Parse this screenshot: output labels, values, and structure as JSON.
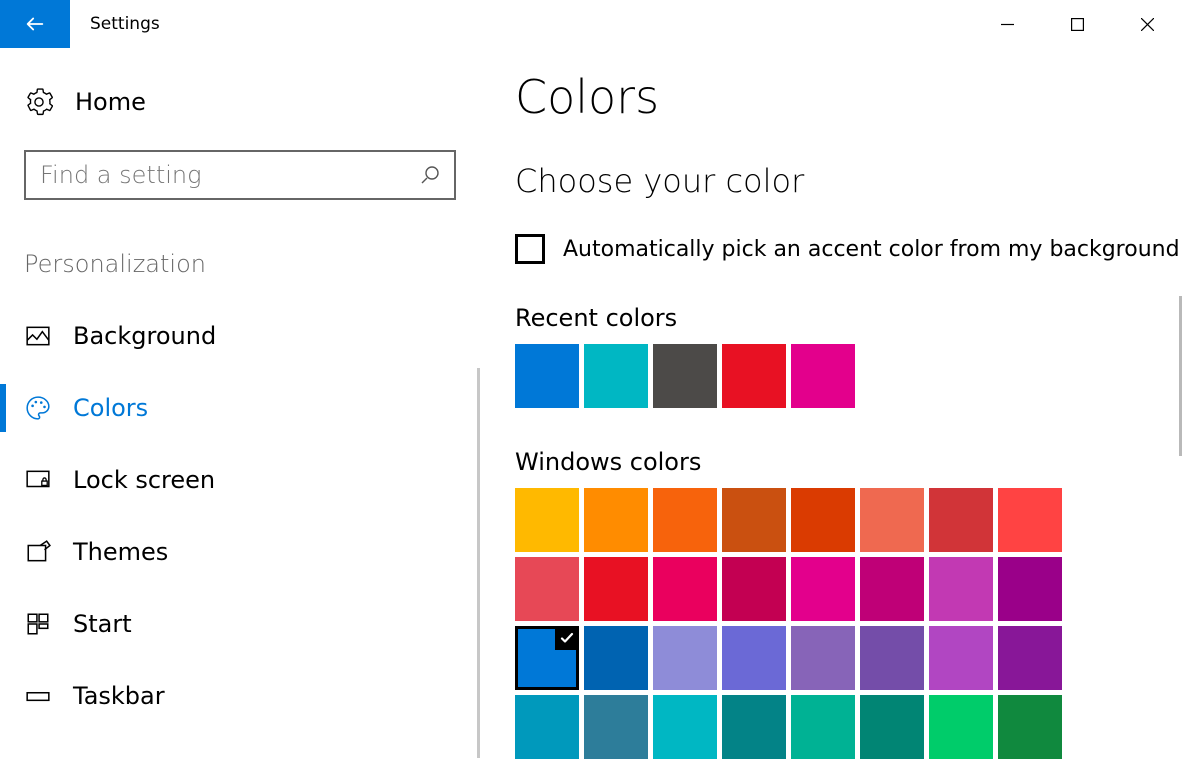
{
  "window": {
    "title": "Settings"
  },
  "sidebar": {
    "home_label": "Home",
    "search_placeholder": "Find a setting",
    "section_label": "Personalization",
    "active_key": "colors",
    "items": [
      {
        "key": "background",
        "label": "Background"
      },
      {
        "key": "colors",
        "label": "Colors"
      },
      {
        "key": "lockscreen",
        "label": "Lock screen"
      },
      {
        "key": "themes",
        "label": "Themes"
      },
      {
        "key": "start",
        "label": "Start"
      },
      {
        "key": "taskbar",
        "label": "Taskbar"
      }
    ]
  },
  "main": {
    "title": "Colors",
    "subhead": "Choose your color",
    "auto_pick_label": "Automatically pick an accent color from my background",
    "auto_pick_checked": false,
    "recent": {
      "label": "Recent colors",
      "colors": [
        "#0078d7",
        "#00b7c3",
        "#4c4a48",
        "#e81123",
        "#e3008c"
      ]
    },
    "windows": {
      "label": "Windows colors",
      "selected_index": 16,
      "colors": [
        "#ffb900",
        "#ff8c00",
        "#f7630c",
        "#ca5010",
        "#da3b01",
        "#ef6950",
        "#d13438",
        "#ff4343",
        "#e74856",
        "#e81123",
        "#ea005e",
        "#c30052",
        "#e3008c",
        "#bf0077",
        "#c239b3",
        "#9a0089",
        "#0078d7",
        "#0063b1",
        "#8e8cd8",
        "#6b69d6",
        "#8764b8",
        "#744da9",
        "#b146c2",
        "#881798",
        "#0099bc",
        "#2d7d9a",
        "#00b7c3",
        "#038387",
        "#00b294",
        "#018574",
        "#00cc6a",
        "#10893e"
      ]
    }
  }
}
